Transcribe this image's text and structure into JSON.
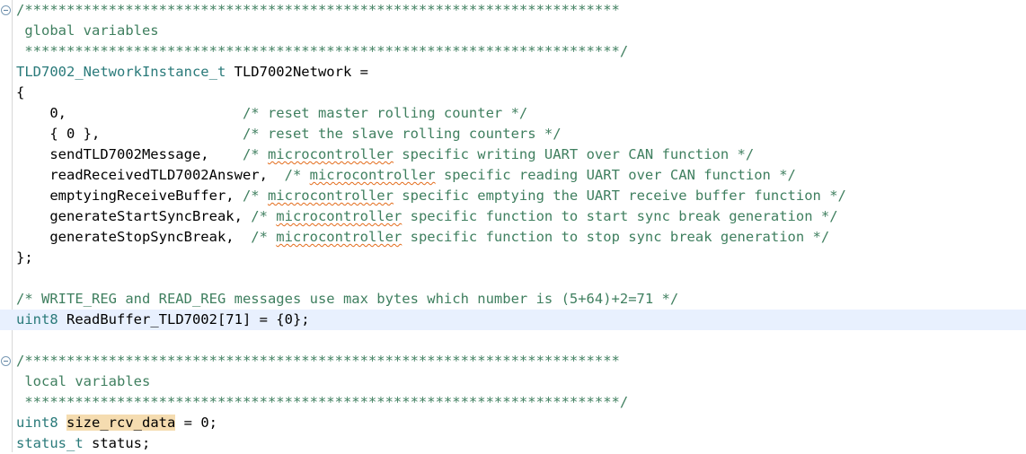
{
  "editor": {
    "app": "code-editor",
    "language": "c",
    "colors": {
      "background": "#ffffff",
      "comment": "#3f7f5f",
      "type": "#2a7a7a",
      "text": "#000000",
      "current_line_highlight": "#e8f0fe",
      "occurrence_highlight": "#f5dcb0",
      "spellcheck_squiggle": "#e36c1b",
      "fold_marker": "#7a9ab5"
    },
    "banner_stars": "***********************************************************************",
    "fold_markers": [
      {
        "name": "fold-marker-global-variables",
        "line": 0
      },
      {
        "name": "fold-marker-local-variables",
        "line": 17
      }
    ],
    "lines": [
      {
        "n": 0,
        "highlight": false,
        "fold": true,
        "segments": [
          {
            "cls": "cmt",
            "text": "/***********************************************************************"
          }
        ]
      },
      {
        "n": 1,
        "highlight": false,
        "fold": false,
        "segments": [
          {
            "cls": "cmt",
            "text": " global variables"
          }
        ]
      },
      {
        "n": 2,
        "highlight": false,
        "fold": false,
        "segments": [
          {
            "cls": "cmt",
            "text": " ***********************************************************************/"
          }
        ]
      },
      {
        "n": 3,
        "highlight": false,
        "fold": false,
        "segments": [
          {
            "cls": "type",
            "text": "TLD7002_NetworkInstance_t"
          },
          {
            "cls": "plain",
            "text": " TLD7002Network ="
          }
        ]
      },
      {
        "n": 4,
        "highlight": false,
        "fold": false,
        "segments": [
          {
            "cls": "plain",
            "text": "{"
          }
        ]
      },
      {
        "n": 5,
        "highlight": false,
        "fold": false,
        "segments": [
          {
            "cls": "plain",
            "text": "    0,                     "
          },
          {
            "cls": "cmt",
            "text": "/* reset master rolling counter */"
          }
        ]
      },
      {
        "n": 6,
        "highlight": false,
        "fold": false,
        "segments": [
          {
            "cls": "plain",
            "text": "    { 0 },                 "
          },
          {
            "cls": "cmt",
            "text": "/* reset the slave rolling counters */"
          }
        ]
      },
      {
        "n": 7,
        "highlight": false,
        "fold": false,
        "segments": [
          {
            "cls": "plain",
            "text": "    sendTLD7002Message,    "
          },
          {
            "cls": "cmt",
            "text": "/* "
          },
          {
            "cls": "cmt squig",
            "text": "microcontroller"
          },
          {
            "cls": "cmt",
            "text": " specific writing UART over CAN function */"
          }
        ]
      },
      {
        "n": 8,
        "highlight": false,
        "fold": false,
        "segments": [
          {
            "cls": "plain",
            "text": "    readReceivedTLD7002Answer,  "
          },
          {
            "cls": "cmt",
            "text": "/* "
          },
          {
            "cls": "cmt squig",
            "text": "microcontroller"
          },
          {
            "cls": "cmt",
            "text": " specific reading UART over CAN function */"
          }
        ]
      },
      {
        "n": 9,
        "highlight": false,
        "fold": false,
        "segments": [
          {
            "cls": "plain",
            "text": "    emptyingReceiveBuffer, "
          },
          {
            "cls": "cmt",
            "text": "/* "
          },
          {
            "cls": "cmt squig",
            "text": "microcontroller"
          },
          {
            "cls": "cmt",
            "text": " specific emptying the UART receive buffer function */"
          }
        ]
      },
      {
        "n": 10,
        "highlight": false,
        "fold": false,
        "segments": [
          {
            "cls": "plain",
            "text": "    generateStartSyncBreak,"
          },
          {
            "cls": "cmt",
            "text": " /* "
          },
          {
            "cls": "cmt squig",
            "text": "microcontroller"
          },
          {
            "cls": "cmt",
            "text": " specific function to start sync break generation */"
          }
        ]
      },
      {
        "n": 11,
        "highlight": false,
        "fold": false,
        "segments": [
          {
            "cls": "plain",
            "text": "    generateStopSyncBreak,  "
          },
          {
            "cls": "cmt",
            "text": "/* "
          },
          {
            "cls": "cmt squig",
            "text": "microcontroller"
          },
          {
            "cls": "cmt",
            "text": " specific function to stop sync break generation */"
          }
        ]
      },
      {
        "n": 12,
        "highlight": false,
        "fold": false,
        "segments": [
          {
            "cls": "plain",
            "text": "};"
          }
        ]
      },
      {
        "n": 13,
        "highlight": false,
        "fold": false,
        "segments": []
      },
      {
        "n": 14,
        "highlight": false,
        "fold": false,
        "segments": [
          {
            "cls": "cmt",
            "text": "/* WRITE_REG and READ_REG messages use max bytes which number is (5+64)+2=71 */"
          }
        ]
      },
      {
        "n": 15,
        "highlight": true,
        "fold": false,
        "segments": [
          {
            "cls": "type",
            "text": "uint8"
          },
          {
            "cls": "plain",
            "text": " ReadBuffer_TLD7002[71] = {0};"
          }
        ]
      },
      {
        "n": 16,
        "highlight": false,
        "fold": false,
        "segments": []
      },
      {
        "n": 17,
        "highlight": false,
        "fold": true,
        "segments": [
          {
            "cls": "cmt",
            "text": "/***********************************************************************"
          }
        ]
      },
      {
        "n": 18,
        "highlight": false,
        "fold": false,
        "segments": [
          {
            "cls": "cmt",
            "text": " local variables"
          }
        ]
      },
      {
        "n": 19,
        "highlight": false,
        "fold": false,
        "segments": [
          {
            "cls": "cmt",
            "text": " ***********************************************************************/"
          }
        ]
      },
      {
        "n": 20,
        "highlight": false,
        "fold": false,
        "segments": [
          {
            "cls": "type",
            "text": "uint8"
          },
          {
            "cls": "plain",
            "text": " "
          },
          {
            "cls": "plain occ",
            "text": "size_rcv_data"
          },
          {
            "cls": "plain",
            "text": " = 0;"
          }
        ]
      },
      {
        "n": 21,
        "highlight": false,
        "fold": false,
        "segments": [
          {
            "cls": "type",
            "text": "status_t"
          },
          {
            "cls": "plain",
            "text": " status;"
          }
        ]
      }
    ]
  }
}
